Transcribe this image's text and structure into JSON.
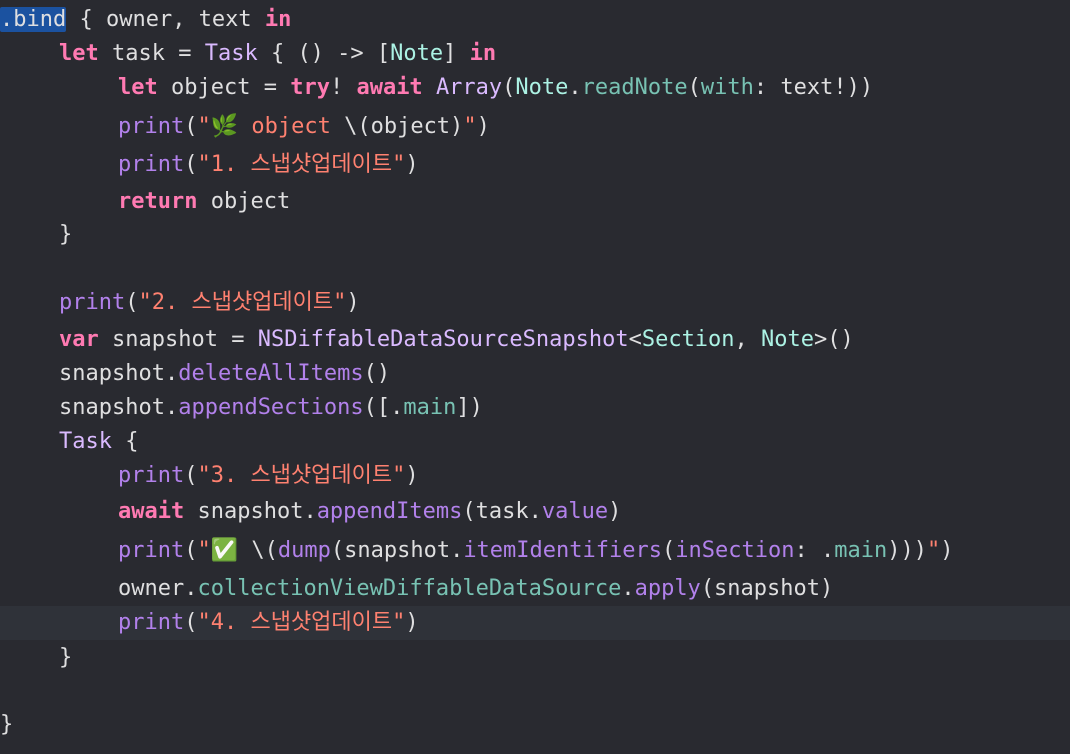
{
  "editor": {
    "language": "Swift",
    "theme": "dark",
    "selection_text": ".bind",
    "current_line_index": 17,
    "colors": {
      "background": "#292a30",
      "current_line": "#2f3239",
      "selection": "#1b52a0",
      "plain": "#dfdfe0",
      "keyword": "#ff7ab2",
      "type": "#dabaff",
      "project_type": "#acf2e4",
      "function": "#b281eb",
      "project_function": "#78c2b3",
      "string": "#ff8170"
    },
    "lines": [
      {
        "indent": 0,
        "tokens": [
          {
            "t": ".bind",
            "k": "selected"
          },
          {
            "t": " { owner, text ",
            "k": "plain"
          },
          {
            "t": "in",
            "k": "keyword"
          }
        ]
      },
      {
        "indent": 1,
        "tokens": [
          {
            "t": "let",
            "k": "keyword"
          },
          {
            "t": " task = ",
            "k": "plain"
          },
          {
            "t": "Task",
            "k": "type"
          },
          {
            "t": " { () -> [",
            "k": "plain"
          },
          {
            "t": "Note",
            "k": "project-type"
          },
          {
            "t": "] ",
            "k": "plain"
          },
          {
            "t": "in",
            "k": "keyword"
          }
        ]
      },
      {
        "indent": 2,
        "tokens": [
          {
            "t": "let",
            "k": "keyword"
          },
          {
            "t": " object = ",
            "k": "plain"
          },
          {
            "t": "try",
            "k": "keyword"
          },
          {
            "t": "! ",
            "k": "plain"
          },
          {
            "t": "await",
            "k": "keyword"
          },
          {
            "t": " ",
            "k": "plain"
          },
          {
            "t": "Array",
            "k": "type"
          },
          {
            "t": "(",
            "k": "plain"
          },
          {
            "t": "Note",
            "k": "project-type"
          },
          {
            "t": ".",
            "k": "plain"
          },
          {
            "t": "readNote",
            "k": "project-func"
          },
          {
            "t": "(",
            "k": "plain"
          },
          {
            "t": "with",
            "k": "project-func"
          },
          {
            "t": ": text!))",
            "k": "plain"
          }
        ]
      },
      {
        "indent": 2,
        "tokens": [
          {
            "t": "print",
            "k": "func"
          },
          {
            "t": "(",
            "k": "plain"
          },
          {
            "t": "\"🌿 object ",
            "k": "string"
          },
          {
            "t": "\\(object)",
            "k": "plain"
          },
          {
            "t": "\"",
            "k": "string"
          },
          {
            "t": ")",
            "k": "plain"
          }
        ]
      },
      {
        "indent": 2,
        "tokens": [
          {
            "t": "print",
            "k": "func"
          },
          {
            "t": "(",
            "k": "plain"
          },
          {
            "t": "\"1. 스냅샷업데이트\"",
            "k": "string"
          },
          {
            "t": ")",
            "k": "plain"
          }
        ]
      },
      {
        "indent": 2,
        "tokens": [
          {
            "t": "return",
            "k": "keyword"
          },
          {
            "t": " object",
            "k": "plain"
          }
        ]
      },
      {
        "indent": 1,
        "tokens": [
          {
            "t": "}",
            "k": "plain"
          }
        ]
      },
      {
        "indent": 0,
        "tokens": []
      },
      {
        "indent": 1,
        "tokens": [
          {
            "t": "print",
            "k": "func"
          },
          {
            "t": "(",
            "k": "plain"
          },
          {
            "t": "\"2. 스냅샷업데이트\"",
            "k": "string"
          },
          {
            "t": ")",
            "k": "plain"
          }
        ]
      },
      {
        "indent": 1,
        "tokens": [
          {
            "t": "var",
            "k": "keyword"
          },
          {
            "t": " snapshot = ",
            "k": "plain"
          },
          {
            "t": "NSDiffableDataSourceSnapshot",
            "k": "type"
          },
          {
            "t": "<",
            "k": "plain"
          },
          {
            "t": "Section",
            "k": "project-type"
          },
          {
            "t": ", ",
            "k": "plain"
          },
          {
            "t": "Note",
            "k": "project-type"
          },
          {
            "t": ">()",
            "k": "plain"
          }
        ]
      },
      {
        "indent": 1,
        "tokens": [
          {
            "t": "snapshot.",
            "k": "plain"
          },
          {
            "t": "deleteAllItems",
            "k": "func"
          },
          {
            "t": "()",
            "k": "plain"
          }
        ]
      },
      {
        "indent": 1,
        "tokens": [
          {
            "t": "snapshot.",
            "k": "plain"
          },
          {
            "t": "appendSections",
            "k": "func"
          },
          {
            "t": "([.",
            "k": "plain"
          },
          {
            "t": "main",
            "k": "project-func"
          },
          {
            "t": "])",
            "k": "plain"
          }
        ]
      },
      {
        "indent": 1,
        "tokens": [
          {
            "t": "Task",
            "k": "type"
          },
          {
            "t": " {",
            "k": "plain"
          }
        ]
      },
      {
        "indent": 2,
        "tokens": [
          {
            "t": "print",
            "k": "func"
          },
          {
            "t": "(",
            "k": "plain"
          },
          {
            "t": "\"3. 스냅샷업데이트\"",
            "k": "string"
          },
          {
            "t": ")",
            "k": "plain"
          }
        ]
      },
      {
        "indent": 2,
        "tokens": [
          {
            "t": "await",
            "k": "keyword"
          },
          {
            "t": " snapshot.",
            "k": "plain"
          },
          {
            "t": "appendItems",
            "k": "func"
          },
          {
            "t": "(task.",
            "k": "plain"
          },
          {
            "t": "value",
            "k": "func"
          },
          {
            "t": ")",
            "k": "plain"
          }
        ]
      },
      {
        "indent": 2,
        "tokens": [
          {
            "t": "print",
            "k": "func"
          },
          {
            "t": "(",
            "k": "plain"
          },
          {
            "t": "\"✅ ",
            "k": "string"
          },
          {
            "t": "\\(",
            "k": "plain"
          },
          {
            "t": "dump",
            "k": "func"
          },
          {
            "t": "(snapshot.",
            "k": "plain"
          },
          {
            "t": "itemIdentifiers",
            "k": "func"
          },
          {
            "t": "(",
            "k": "plain"
          },
          {
            "t": "inSection",
            "k": "func"
          },
          {
            "t": ": .",
            "k": "plain"
          },
          {
            "t": "main",
            "k": "project-func"
          },
          {
            "t": ")))",
            "k": "plain"
          },
          {
            "t": "\"",
            "k": "string"
          },
          {
            "t": ")",
            "k": "plain"
          }
        ]
      },
      {
        "indent": 2,
        "tokens": [
          {
            "t": "owner.",
            "k": "plain"
          },
          {
            "t": "collectionViewDiffableDataSource",
            "k": "project-func"
          },
          {
            "t": ".",
            "k": "plain"
          },
          {
            "t": "apply",
            "k": "func"
          },
          {
            "t": "(snapshot)",
            "k": "plain"
          }
        ]
      },
      {
        "indent": 2,
        "tokens": [
          {
            "t": "print",
            "k": "func"
          },
          {
            "t": "(",
            "k": "plain"
          },
          {
            "t": "\"4. 스냅샷업데이트\"",
            "k": "string"
          },
          {
            "t": ")",
            "k": "plain"
          }
        ]
      },
      {
        "indent": 1,
        "tokens": [
          {
            "t": "}",
            "k": "plain"
          }
        ]
      },
      {
        "indent": 0,
        "tokens": []
      },
      {
        "indent": 0,
        "tokens": [
          {
            "t": "}",
            "k": "plain"
          }
        ]
      }
    ]
  }
}
